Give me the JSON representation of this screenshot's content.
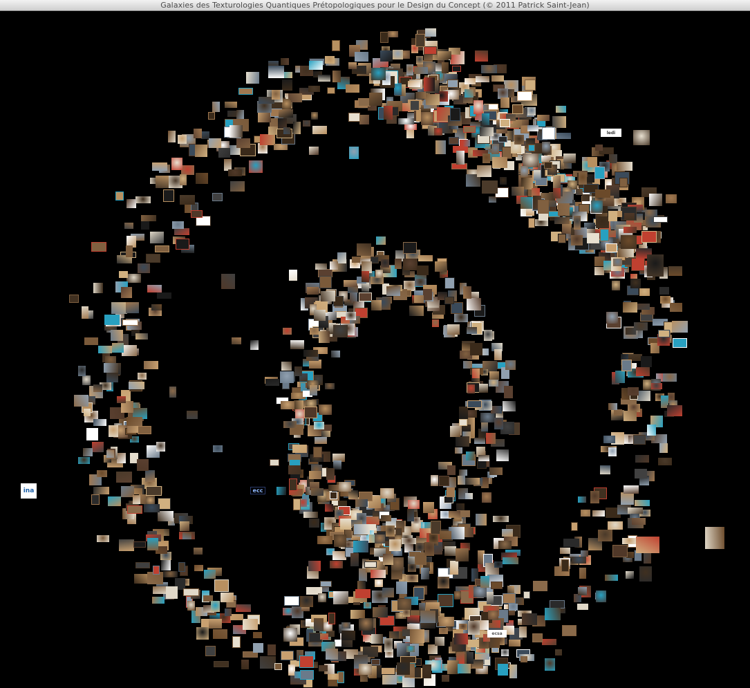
{
  "window": {
    "title": "Galaxies des Texturologies Quantiques Prétopologiques pour le Design du Concept (© 2011 Patrick Saint-Jean)"
  },
  "thumbnails": {
    "labeled": [
      {
        "text": "ina",
        "bg": "#ffffff",
        "fg": "#1a5fa8"
      },
      {
        "text": "ecc",
        "bg": "#000000",
        "fg": "#8fb8ff"
      },
      {
        "text": "ledi",
        "bg": "#ffffff",
        "fg": "#333333"
      },
      {
        "text": "ecsa",
        "bg": "#ffffff",
        "fg": "#555555"
      }
    ],
    "palette": [
      "#3a2a1a",
      "#6b4a2a",
      "#8a6a4a",
      "#2a2a2a",
      "#4a3a2a",
      "#a07850",
      "#5a4030",
      "#c8a070",
      "#1a1a1a",
      "#7a5a3a",
      "#e8e0d0",
      "#ffffff",
      "#b89060",
      "#403020",
      "#90a0b0",
      "#6a7a8a",
      "#d0b080",
      "#503828",
      "#c04030",
      "#3a4a5a",
      "#e0d8c8",
      "#806040",
      "#28a0c0",
      "#404040"
    ]
  }
}
